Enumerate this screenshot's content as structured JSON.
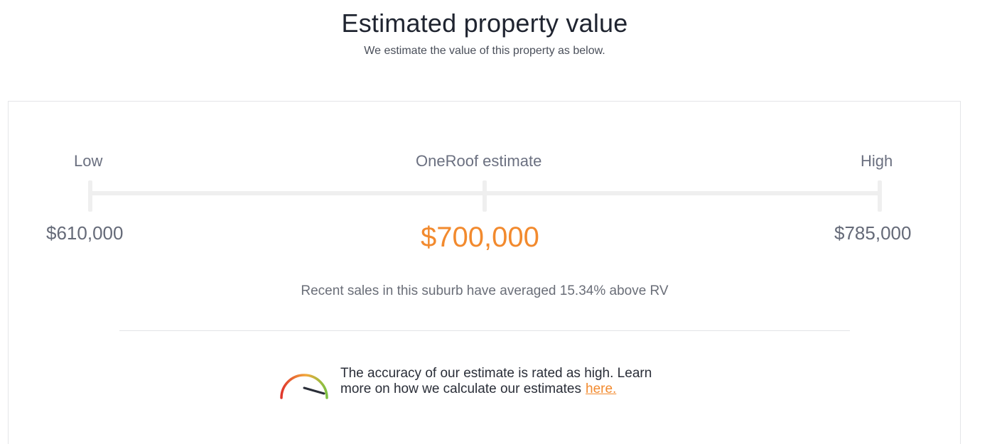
{
  "header": {
    "title": "Estimated property value",
    "subtitle": "We estimate the value of this property as below."
  },
  "estimate": {
    "low_label": "Low",
    "mid_label": "OneRoof estimate",
    "high_label": "High",
    "low_value": "$610,000",
    "mid_value": "$700,000",
    "high_value": "$785,000"
  },
  "sales_note": "Recent sales in this suburb have averaged 15.34% above RV",
  "accuracy": {
    "line1": "The accuracy of our estimate is rated as high. Learn",
    "line2": "more on how we calculate our estimates",
    "link_text": "here.",
    "gauge_icon": "accuracy-gauge-icon",
    "level": "high"
  },
  "colors": {
    "accent": "#f28a2e",
    "gauge_low": "#e0362c",
    "gauge_mid": "#f2a93b",
    "gauge_high": "#7cc242"
  }
}
